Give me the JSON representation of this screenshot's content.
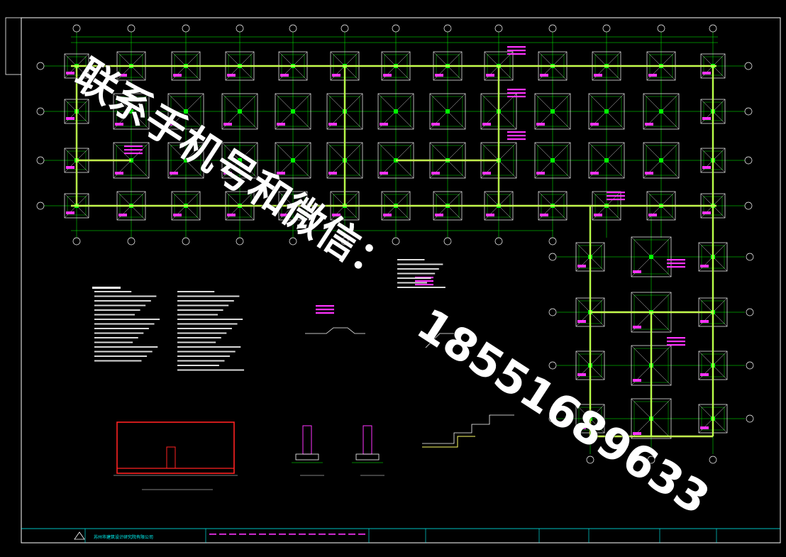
{
  "watermark": {
    "line1": "联系手机号和微信：",
    "line2": "18551689633"
  },
  "title_block": {
    "company": "苏州市建筑设计研究院有限公司"
  },
  "drawing": {
    "colors": {
      "background": "#000000",
      "grid_green": "#00ff00",
      "beam_yellow": "#ffff66",
      "label_magenta": "#ff33ff",
      "footing_white": "#ffffff",
      "section_red": "#ff2222",
      "border_cyan": "#00ffff"
    }
  }
}
